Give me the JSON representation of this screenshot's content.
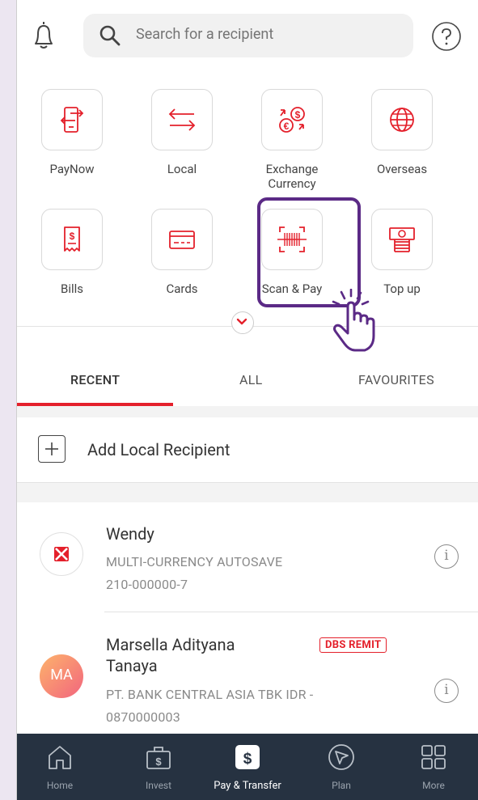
{
  "header": {
    "search_placeholder": "Search for a recipient"
  },
  "grid": [
    {
      "label": "PayNow",
      "icon": "paynow-icon"
    },
    {
      "label": "Local",
      "icon": "transfer-arrows-icon"
    },
    {
      "label": "Exchange Currency",
      "icon": "currency-exchange-icon"
    },
    {
      "label": "Overseas",
      "icon": "globe-icon"
    },
    {
      "label": "Bills",
      "icon": "receipt-icon"
    },
    {
      "label": "Cards",
      "icon": "credit-card-icon"
    },
    {
      "label": "Scan & Pay",
      "icon": "barcode-scan-icon"
    },
    {
      "label": "Top up",
      "icon": "cash-stack-icon"
    }
  ],
  "tabs": [
    "RECENT",
    "ALL",
    "FAVOURITES"
  ],
  "add_recipient": "Add Local Recipient",
  "recipients": [
    {
      "name": "Wendy",
      "line1": "MULTI-CURRENCY AUTOSAVE",
      "line2": "210-000000-7"
    },
    {
      "name_line1": "Marsella Adityana",
      "name_line2": "Tanaya",
      "initials": "MA",
      "badge": "DBS REMIT",
      "line1": "PT. BANK CENTRAL ASIA TBK IDR -",
      "line2": "0870000003"
    }
  ],
  "nav": [
    "Home",
    "Invest",
    "Pay & Transfer",
    "Plan",
    "More"
  ],
  "colors": {
    "accent_red": "#e4202b",
    "nav_bg": "#263241",
    "highlight": "#5b2a86"
  }
}
